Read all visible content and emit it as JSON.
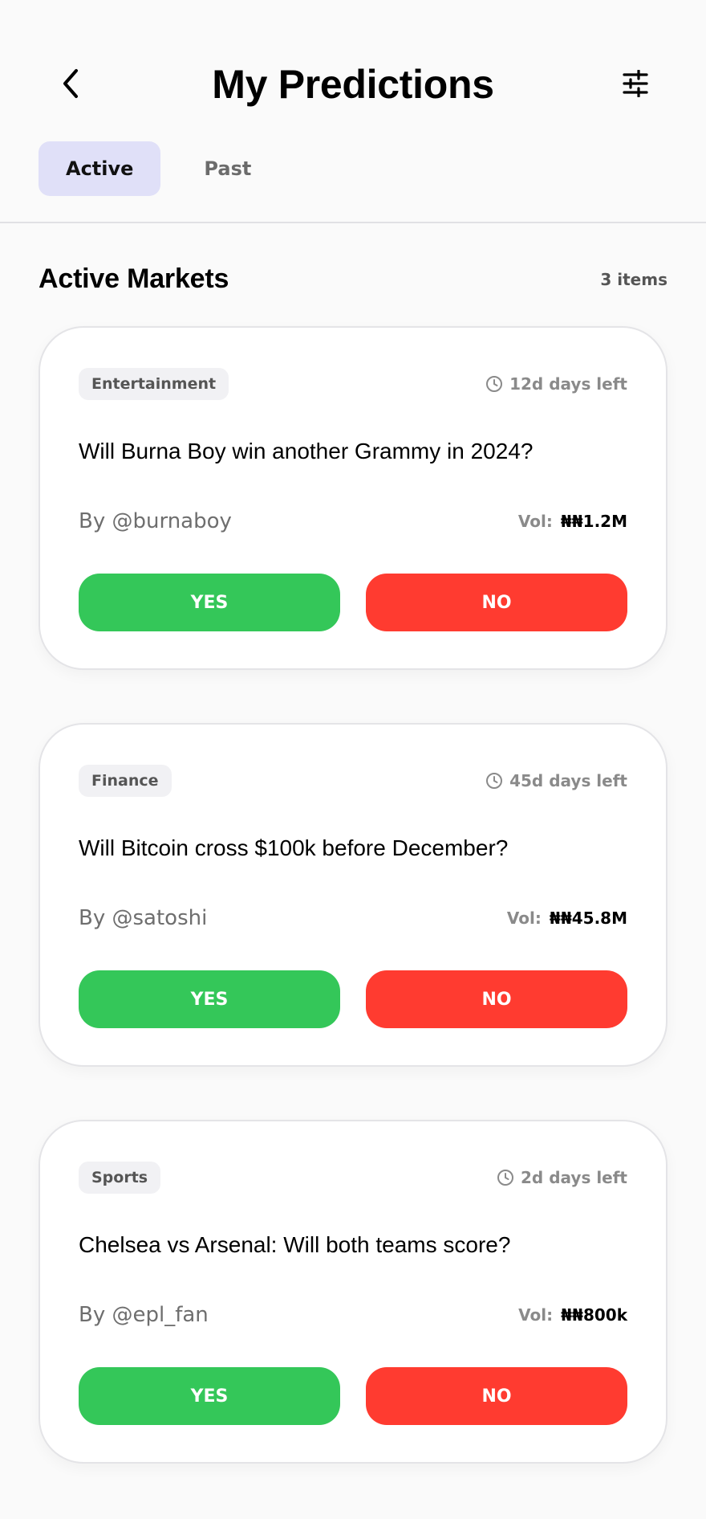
{
  "header": {
    "title": "My Predictions",
    "back_icon": "chevron-left-icon",
    "filter_icon": "sliders-icon"
  },
  "tabs": [
    {
      "label": "Active",
      "active": true
    },
    {
      "label": "Past",
      "active": false
    }
  ],
  "section": {
    "title": "Active Markets",
    "count": "3 items"
  },
  "markets": [
    {
      "category": "Entertainment",
      "days_left": "12d days left",
      "question": "Will Burna Boy win another Grammy in 2024?",
      "author": "By @burnaboy",
      "vol_label": "Vol:",
      "vol_value": "₦₦1.2M",
      "yes_label": "YES",
      "no_label": "NO"
    },
    {
      "category": "Finance",
      "days_left": "45d days left",
      "question": "Will Bitcoin cross $100k before December?",
      "author": "By @satoshi",
      "vol_label": "Vol:",
      "vol_value": "₦₦45.8M",
      "yes_label": "YES",
      "no_label": "NO"
    },
    {
      "category": "Sports",
      "days_left": "2d days left",
      "question": "Chelsea vs Arsenal: Will both teams score?",
      "author": "By @epl_fan",
      "vol_label": "Vol:",
      "vol_value": "₦₦800k",
      "yes_label": "YES",
      "no_label": "NO"
    }
  ],
  "colors": {
    "yes": "#34c759",
    "no": "#ff3b30",
    "active_tab": "#e0e0f8"
  }
}
